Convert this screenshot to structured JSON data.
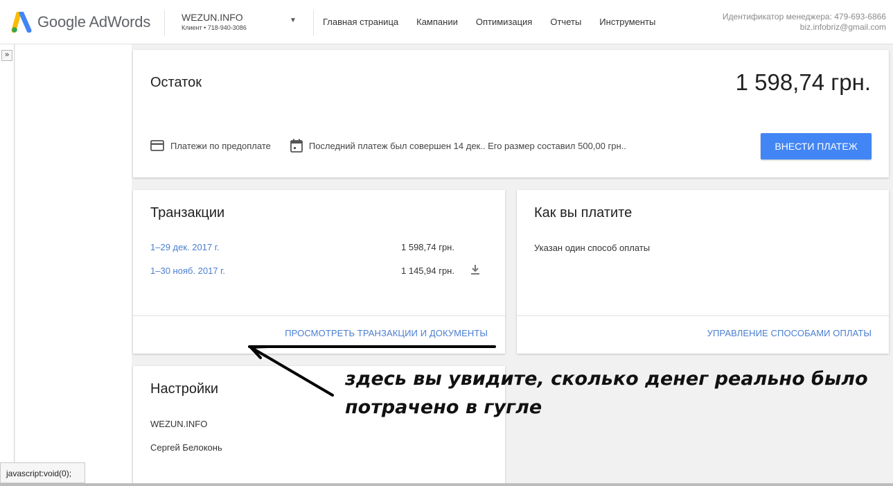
{
  "header": {
    "logo_text": "Google AdWords",
    "account_name": "WEZUN.INFO",
    "account_sub": "Клиент  •  718-940-3086",
    "nav": [
      "Главная страница",
      "Кампании",
      "Оптимизация",
      "Отчеты",
      "Инструменты"
    ],
    "manager_id": "Идентификатор менеджера: 479-693-6866",
    "manager_email": "biz.infobriz@gmail.com"
  },
  "sidebar": {
    "expand_label": "»"
  },
  "balance": {
    "title": "Остаток",
    "amount": "1 598,74 грн.",
    "prepay_label": "Платежи по предоплате",
    "last_payment": "Последний платеж был совершен 14 дек.. Его размер составил 500,00 грн..",
    "pay_button": "ВНЕСТИ ПЛАТЕЖ"
  },
  "transactions": {
    "title": "Транзакции",
    "rows": [
      {
        "date": "1–29 дек. 2017 г.",
        "amount": "1 598,74 грн."
      },
      {
        "date": "1–30 нояб. 2017 г.",
        "amount": "1 145,94 грн."
      }
    ],
    "link": "ПРОСМОТРЕТЬ ТРАНЗАКЦИИ И ДОКУМЕНТЫ"
  },
  "payment": {
    "title": "Как вы платите",
    "text": "Указан один способ оплаты",
    "link": "УПРАВЛЕНИЕ СПОСОБАМИ ОПЛАТЫ"
  },
  "settings": {
    "title": "Настройки",
    "account": "WEZUN.INFO",
    "name": "Сергей Белоконь"
  },
  "annotation": {
    "line1": "здесь вы увидите, сколько денег реально было",
    "line2": "потрачено в гугле"
  },
  "statusbar": {
    "text": "javascript:void(0);"
  },
  "colors": {
    "accent": "#4285f4",
    "link": "#4a7ecf"
  }
}
